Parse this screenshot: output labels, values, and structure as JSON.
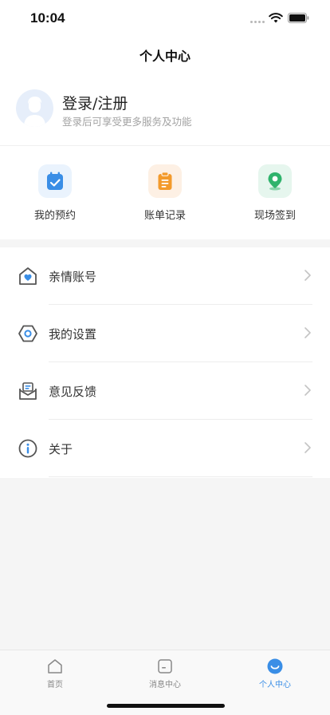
{
  "status_bar": {
    "time": "10:04"
  },
  "nav": {
    "title": "个人中心"
  },
  "profile": {
    "name": "登录/注册",
    "subtitle": "登录后可享受更多服务及功能"
  },
  "quick_actions": [
    {
      "label": "我的预约",
      "icon": "calendar-check-icon",
      "color": "#3a8ee6",
      "bg": "#eaf3fd"
    },
    {
      "label": "账单记录",
      "icon": "clipboard-list-icon",
      "color": "#f39a2b",
      "bg": "#fdf0e4"
    },
    {
      "label": "现场签到",
      "icon": "location-pin-icon",
      "color": "#2fb36c",
      "bg": "#e6f6ee"
    }
  ],
  "menu": [
    {
      "label": "亲情账号",
      "icon": "family-home-heart-icon"
    },
    {
      "label": "我的设置",
      "icon": "settings-hexagon-icon"
    },
    {
      "label": "意见反馈",
      "icon": "feedback-mail-icon"
    },
    {
      "label": "关于",
      "icon": "info-circle-icon"
    }
  ],
  "tabs": [
    {
      "label": "首页",
      "icon": "home-icon"
    },
    {
      "label": "消息中心",
      "icon": "message-icon"
    },
    {
      "label": "个人中心",
      "icon": "profile-smile-icon",
      "active": true
    }
  ],
  "colors": {
    "accent": "#3a8ee6",
    "text": "#333333",
    "muted": "#a3a3a3",
    "background": "#f5f5f5"
  }
}
